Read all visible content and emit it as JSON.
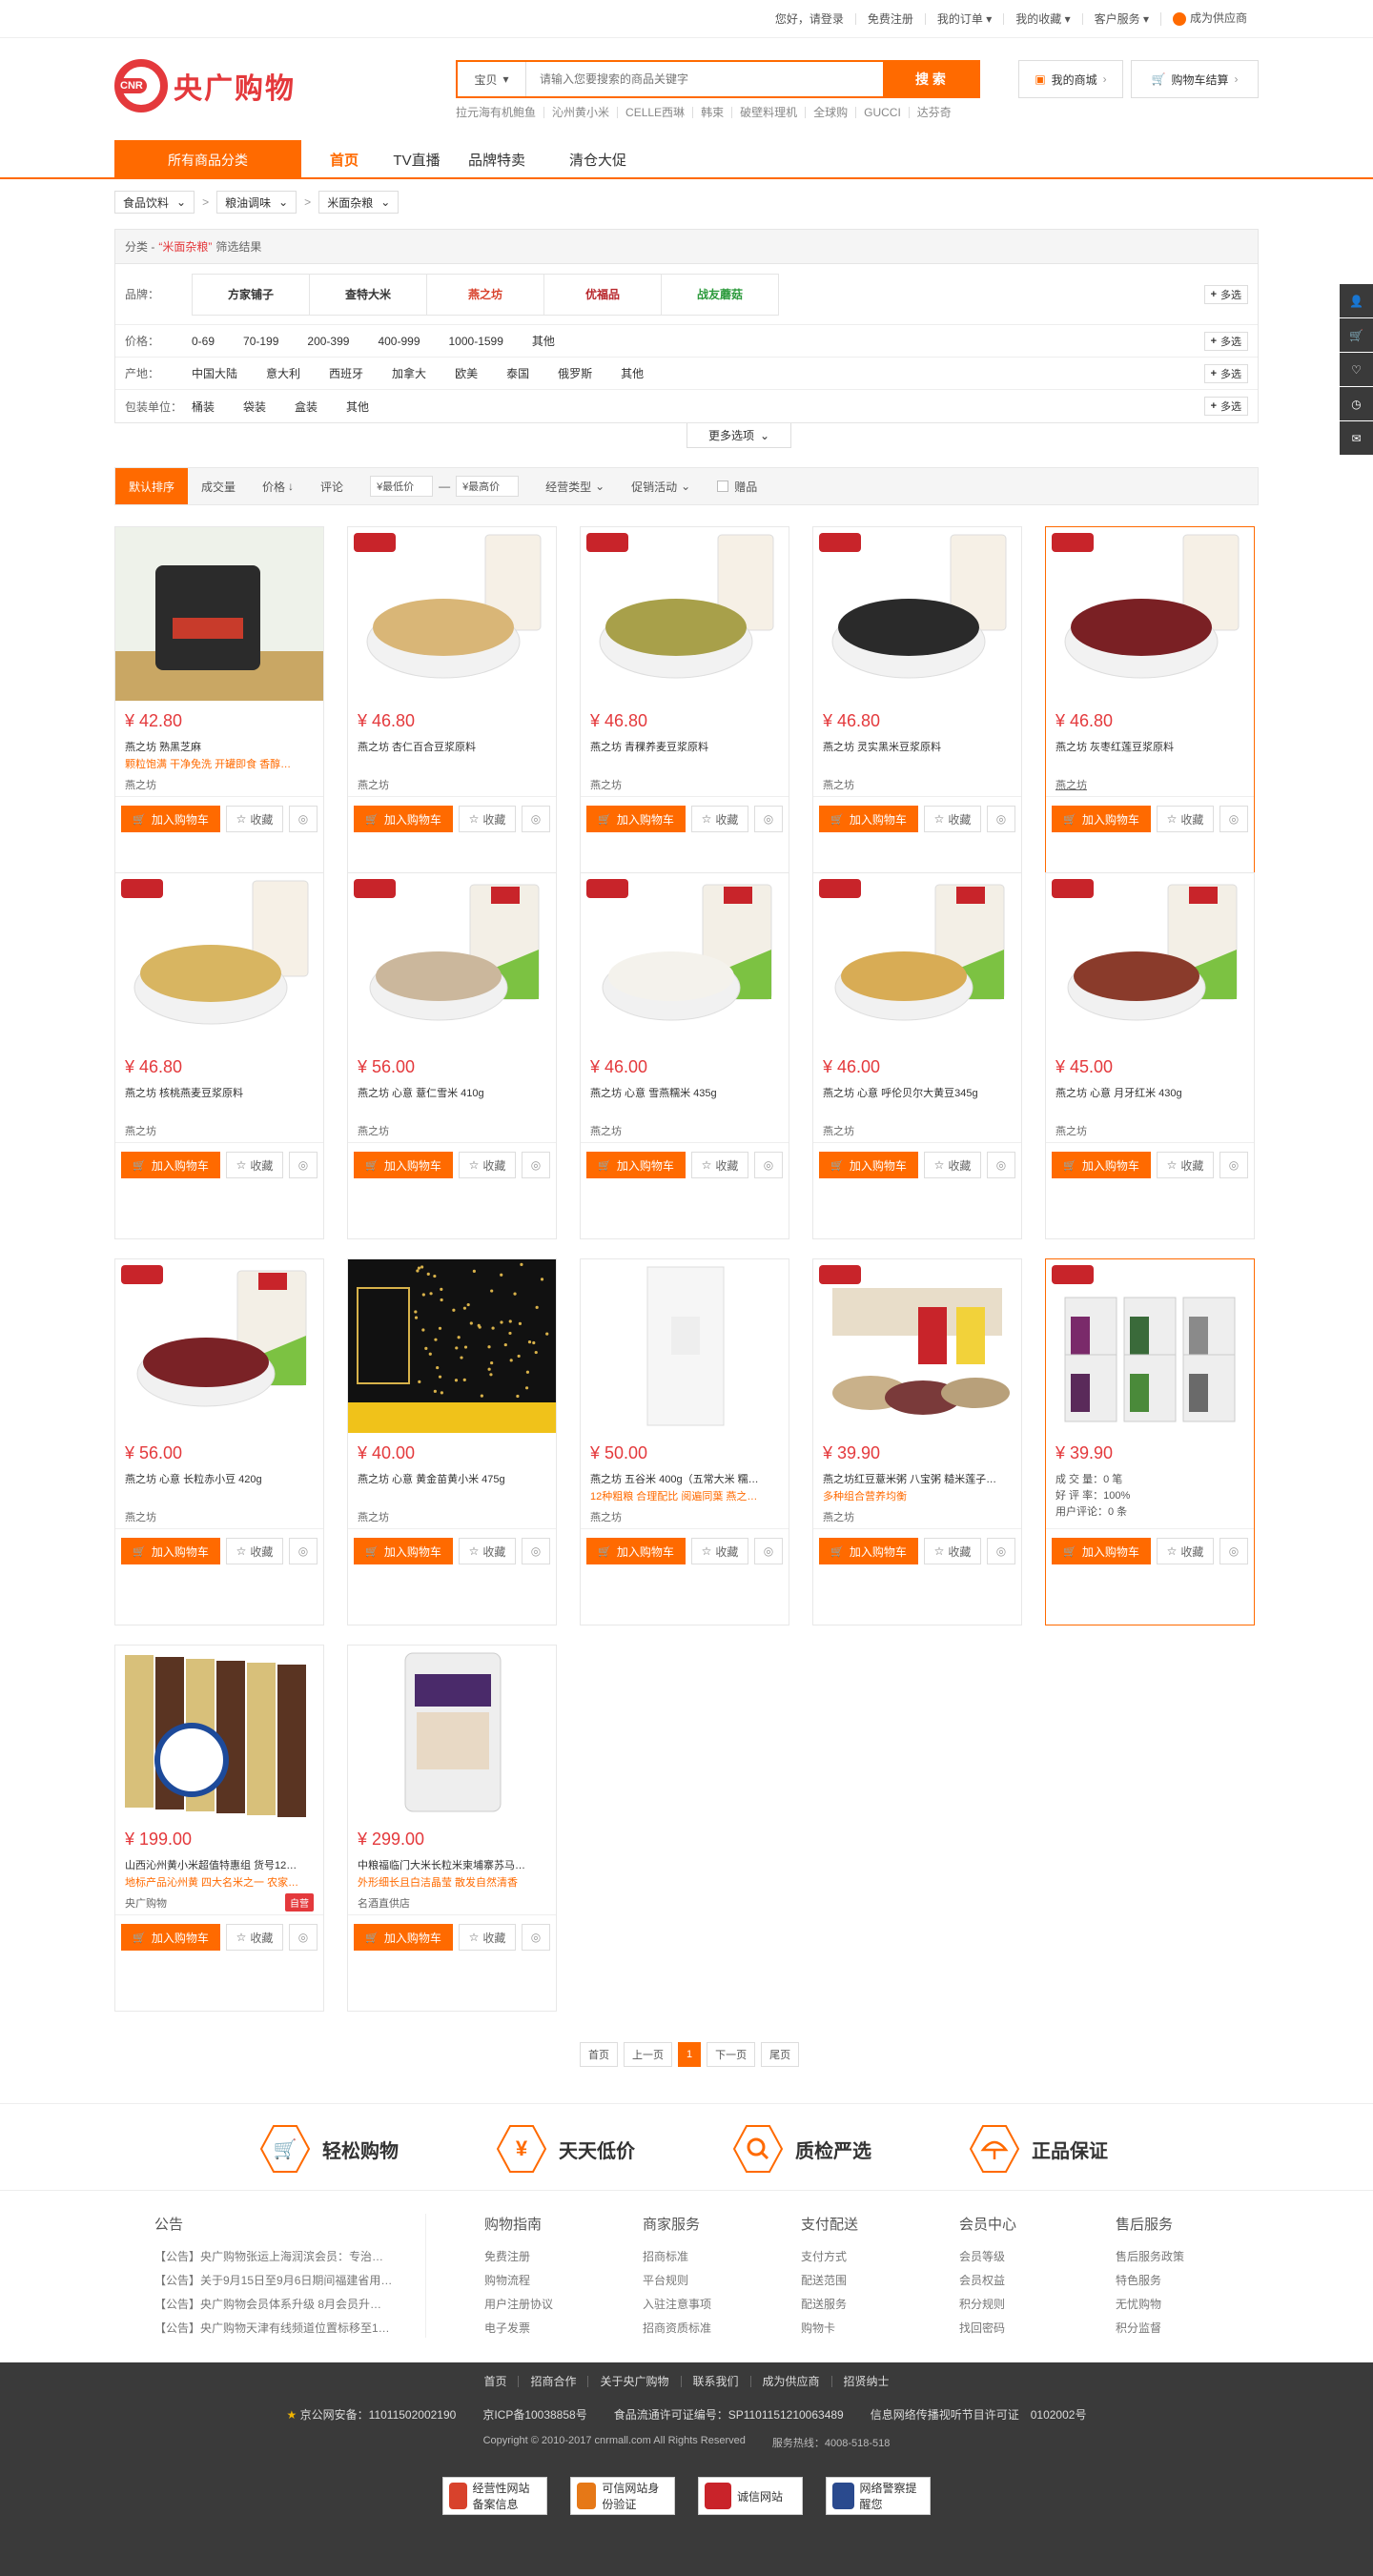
{
  "topbar": {
    "greeting": "您好，请登录",
    "register": "免费注册",
    "my_orders": "我的订单",
    "my_favorites": "我的收藏",
    "service": "客户服务",
    "supplier": "成为供应商"
  },
  "header": {
    "logo_badge": "CNR",
    "logo_text": "央广购物",
    "search_scope": "宝贝",
    "search_placeholder": "请输入您要搜索的商品关键字",
    "search_button": "搜 索",
    "hot_words": [
      "拉元海有机鲍鱼",
      "沁州黄小米",
      "CELLE西琳",
      "韩束",
      "破壁料理机",
      "全球购",
      "GUCCI",
      "达芬奇"
    ],
    "my_mall": "我的商城",
    "cart": "购物车结算"
  },
  "nav": {
    "all_categories": "所有商品分类",
    "items": [
      "首页",
      "TV直播",
      "品牌特卖",
      "清仓大促"
    ]
  },
  "breadcrumb": [
    "食品饮料",
    "粮油调味",
    "米面杂粮"
  ],
  "filter": {
    "head_prefix": "分类 -",
    "keyword": "“米面杂粮”",
    "head_suffix": "筛选结果",
    "brand_label": "品牌：",
    "brands": [
      "方家铺子",
      "查特大米",
      "燕之坊",
      "优福品",
      "战友蘑菇"
    ],
    "price_label": "价格：",
    "prices": [
      "0-69",
      "70-199",
      "200-399",
      "400-999",
      "1000-1599",
      "其他"
    ],
    "origin_label": "产地：",
    "origins": [
      "中国大陆",
      "意大利",
      "西班牙",
      "加拿大",
      "欧美",
      "泰国",
      "俄罗斯",
      "其他"
    ],
    "pack_label": "包装单位：",
    "packs": [
      "桶装",
      "袋装",
      "盒装",
      "其他"
    ],
    "more": "多选",
    "more_options": "更多选项"
  },
  "sortbar": {
    "default": "默认排序",
    "sales": "成交量",
    "price": "价格",
    "reviews": "评论",
    "min_price": "¥最低价",
    "dash": "—",
    "max_price": "¥最高价",
    "biz_type": "经营类型",
    "promo": "促销活动",
    "gift": "赠品"
  },
  "product_actions": {
    "add_cart": "加入购物车",
    "fav": "收藏"
  },
  "products": [
    {
      "price": "¥ 42.80",
      "name": "燕之坊 熟黑芝麻",
      "promo": "颗粒饱满 干净免洗 开罐即食 香醇…",
      "shop": "燕之坊"
    },
    {
      "price": "¥ 46.80",
      "name": "燕之坊 杏仁百合豆浆原料",
      "promo": "",
      "shop": "燕之坊"
    },
    {
      "price": "¥ 46.80",
      "name": "燕之坊 青稞养麦豆浆原料",
      "promo": "",
      "shop": "燕之坊"
    },
    {
      "price": "¥ 46.80",
      "name": "燕之坊 灵实黑米豆浆原料",
      "promo": "",
      "shop": "燕之坊"
    },
    {
      "price": "¥ 46.80",
      "name": "燕之坊 灰枣红莲豆浆原料",
      "promo": "",
      "shop": "燕之坊"
    },
    {
      "price": "¥ 46.80",
      "name": "燕之坊 核桃燕麦豆浆原料",
      "promo": "",
      "shop": "燕之坊"
    },
    {
      "price": "¥ 56.00",
      "name": "燕之坊 心意 薏仁雪米 410g",
      "promo": "",
      "shop": "燕之坊"
    },
    {
      "price": "¥ 46.00",
      "name": "燕之坊 心意 雪燕糯米 435g",
      "promo": "",
      "shop": "燕之坊"
    },
    {
      "price": "¥ 46.00",
      "name": "燕之坊 心意 呼伦贝尔大黄豆345g",
      "promo": "",
      "shop": "燕之坊"
    },
    {
      "price": "¥ 45.00",
      "name": "燕之坊 心意 月牙红米 430g",
      "promo": "",
      "shop": "燕之坊"
    },
    {
      "price": "¥ 56.00",
      "name": "燕之坊 心意 长粒赤小豆 420g",
      "promo": "",
      "shop": "燕之坊"
    },
    {
      "price": "¥ 40.00",
      "name": "燕之坊 心意 黄金苗黄小米 475g",
      "promo": "",
      "shop": "燕之坊"
    },
    {
      "price": "¥ 50.00",
      "name": "燕之坊 五谷米 400g（五常大米 糯…",
      "promo": "12种粗粮 合理配比 阅遍同葉 燕之…",
      "shop": "燕之坊"
    },
    {
      "price": "¥ 39.90",
      "name": "燕之坊红豆薏米粥 八宝粥 糙米莲子…",
      "promo": "多种组合营养均衡",
      "shop": "燕之坊"
    },
    {
      "price": "¥ 39.90",
      "name": "",
      "promo": "",
      "shop": "",
      "stats": [
        "成 交 量：0 笔",
        "好 评 率：100%",
        "用户评论：0 条"
      ]
    },
    {
      "price": "¥ 199.00",
      "name": "山西沁州黄小米超值特惠组 货号12…",
      "promo": "地标产品沁州黄 四大名米之一 农家…",
      "shop": "央广购物",
      "self": "自营"
    },
    {
      "price": "¥ 299.00",
      "name": "中粮福临门大米长粒米柬埔寨苏马…",
      "promo": "外形细长且白洁晶莹 散发自然清香",
      "shop": "名酒直供店"
    }
  ],
  "pager": [
    "首页",
    "上一页",
    "1",
    "下一页",
    "尾页"
  ],
  "features": [
    "轻松购物",
    "天天低价",
    "质检严选",
    "正品保证"
  ],
  "footer": {
    "notice_title": "公告",
    "notices": [
      "【公告】央广购物张运上海润滨会员：专治…",
      "【公告】关于9月15日至9月6日期间福建省用…",
      "【公告】央广购物会员体系升级 8月会员升…",
      "【公告】央广购物天津有线频道位置标移至1…"
    ],
    "cols": [
      {
        "title": "购物指南",
        "items": [
          "免费注册",
          "购物流程",
          "用户注册协议",
          "电子发票"
        ]
      },
      {
        "title": "商家服务",
        "items": [
          "招商标准",
          "平台规则",
          "入驻注意事项",
          "招商资质标准"
        ]
      },
      {
        "title": "支付配送",
        "items": [
          "支付方式",
          "配送范围",
          "配送服务",
          "购物卡"
        ]
      },
      {
        "title": "会员中心",
        "items": [
          "会员等级",
          "会员权益",
          "积分规则",
          "找回密码"
        ]
      },
      {
        "title": "售后服务",
        "items": [
          "售后服务政策",
          "特色服务",
          "无忧购物",
          "积分监督"
        ]
      }
    ]
  },
  "bottom": {
    "links": [
      "首页",
      "招商合作",
      "关于央广购物",
      "联系我们",
      "成为供应商",
      "招贤纳士"
    ],
    "info": [
      "京公网安备：11011502002190",
      "京ICP备10038858号",
      "食品流通许可证编号：SP1101151210063489",
      "信息网络传播视听节目许可证　0102002号"
    ],
    "copyright": "Copyright © 2010-2017  cnrmall.com  All  Rights  Reserved",
    "hotline": "服务热线：4008-518-518",
    "badges": [
      "经营性网站备案信息",
      "可信网站身份验证",
      "诚信网站",
      "网络警察提醒您"
    ]
  },
  "colors": {
    "accent": "#ff6a00",
    "price": "#e4393c",
    "dark": "#3a3a3a"
  }
}
